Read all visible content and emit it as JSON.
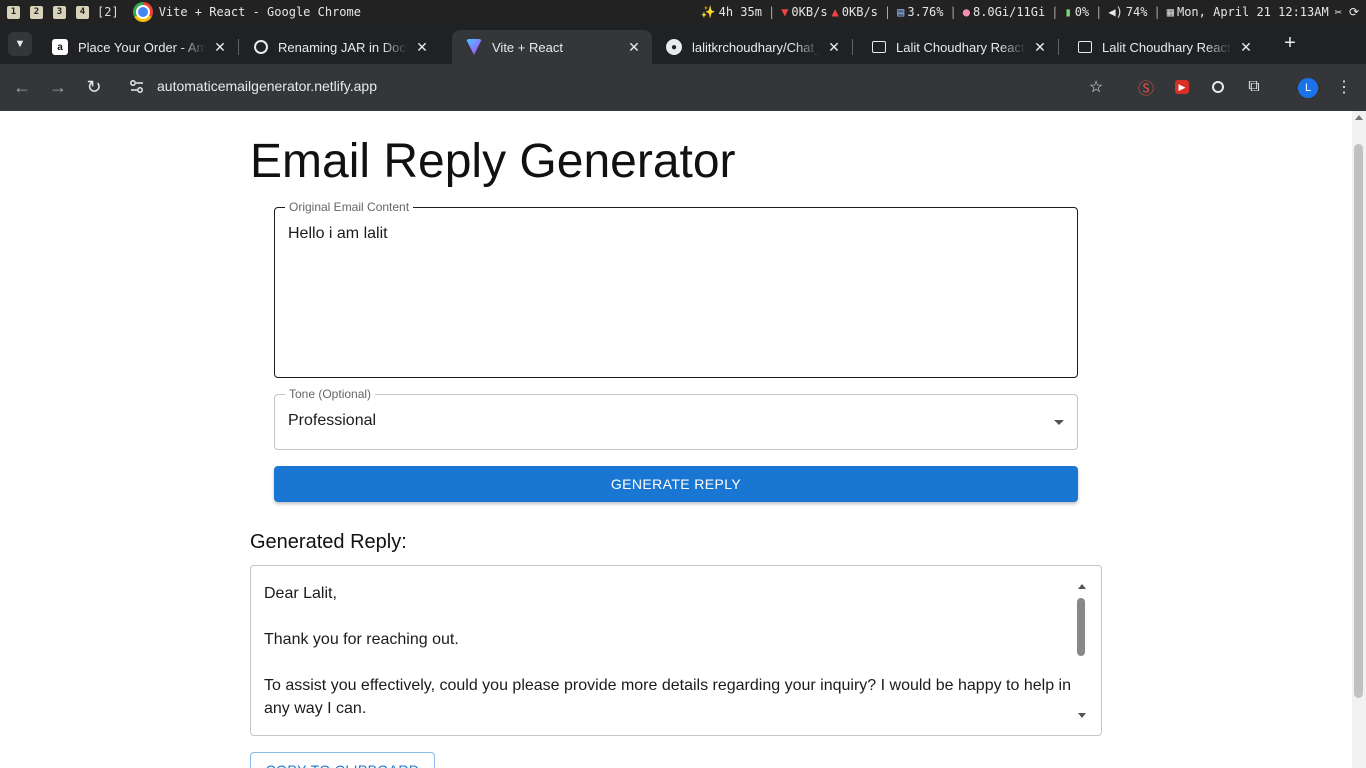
{
  "system_bar": {
    "workspaces": [
      "1",
      "2",
      "3",
      "4"
    ],
    "workspace_count": "[2]",
    "window_title": "Vite + React - Google Chrome",
    "battery_time": "4h 35m",
    "net_down": "0KB/s",
    "net_up": "0KB/s",
    "cpu": "3.76%",
    "memory": "8.0Gi/11Gi",
    "battery": "0%",
    "volume": "74%",
    "datetime": "Mon, April 21 12:13AM"
  },
  "tabs": [
    {
      "title": "Place Your Order - Amazon",
      "favicon": "amazon-icon",
      "active": false
    },
    {
      "title": "Renaming JAR in Docker",
      "favicon": "chatgpt-icon",
      "active": false
    },
    {
      "title": "Vite + React",
      "favicon": "vite-icon",
      "active": true
    },
    {
      "title": "lalitkrchoudhary/Chat_",
      "favicon": "github-icon",
      "active": false
    },
    {
      "title": "Lalit Choudhary React-F",
      "favicon": "image-icon",
      "active": false
    },
    {
      "title": "Lalit Choudhary React-F",
      "favicon": "image-icon",
      "active": false
    }
  ],
  "toolbar": {
    "url": "automaticemailgenerator.netlify.app",
    "avatar_letter": "L"
  },
  "page": {
    "title": "Email Reply Generator",
    "email_label": "Original Email Content",
    "email_value": "Hello i am lalit",
    "tone_label": "Tone (Optional)",
    "tone_value": "Professional",
    "generate_button": "GENERATE REPLY",
    "reply_heading": "Generated Reply:",
    "reply_paragraphs": [
      "Dear Lalit,",
      "Thank you for reaching out.",
      "To assist you effectively, could you please provide more details regarding your inquiry? I would be happy to help in any way I can."
    ],
    "copy_button": "COPY TO CLIPBOARD"
  },
  "colors": {
    "primary": "#1976d2",
    "chrome_dark": "#202124",
    "chrome_toolbar": "#35363a"
  }
}
